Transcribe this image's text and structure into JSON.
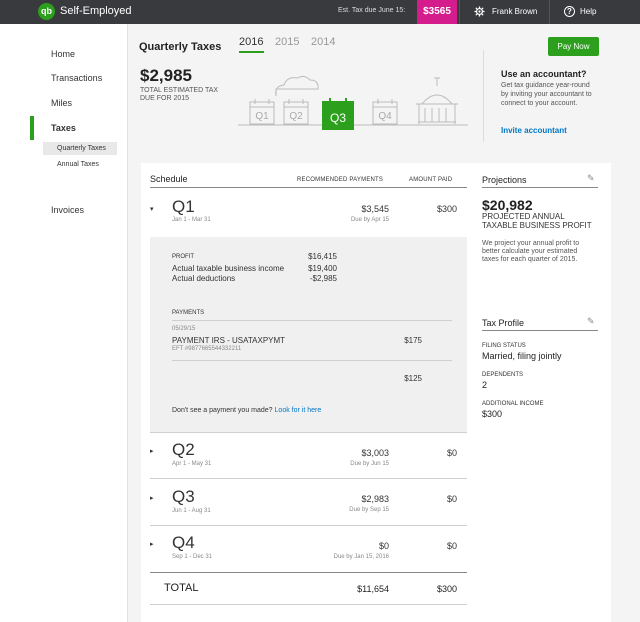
{
  "topbar": {
    "app_title": "Self-Employed",
    "tax_due_label": "Est. Tax due June 15:",
    "tax_due_amount": "$3565",
    "user_name": "Frank Brown",
    "help_label": "Help",
    "colors": {
      "bar": "#393a3d",
      "badge": "#d51c8c",
      "brand": "#2ca01c"
    }
  },
  "sidebar": {
    "items": [
      {
        "label": "Home"
      },
      {
        "label": "Transactions"
      },
      {
        "label": "Miles"
      },
      {
        "label": "Taxes",
        "active": true
      },
      {
        "label": "Invoices"
      }
    ],
    "subitems": [
      {
        "label": "Quarterly Taxes",
        "active": true
      },
      {
        "label": "Annual Taxes"
      }
    ]
  },
  "header": {
    "title": "Quarterly Taxes",
    "years": [
      "2016",
      "2015",
      "2014"
    ],
    "selected_year": "2016",
    "est_amount": "$2,985",
    "est_label": "TOTAL ESTIMATED TAX DUE FOR 2015",
    "calendar_labels": [
      "Q1",
      "Q2",
      "Q3",
      "Q4"
    ],
    "current_quarter": "Q3",
    "pay_now": "Pay Now",
    "accountant": {
      "title": "Use an accountant?",
      "text": "Get tax guidance year-round by inviting your accountant to connect to your account.",
      "link": "Invite accountant"
    }
  },
  "schedule": {
    "title": "Schedule",
    "col_recommended": "RECOMMENDED PAYMENTS",
    "col_paid": "AMOUNT PAID",
    "quarters": [
      {
        "label": "Q1",
        "dates": "Jan 1 - Mar 31",
        "recommended": "$3,545",
        "due": "Due by Apr 15",
        "paid": "$300",
        "expanded": true
      },
      {
        "label": "Q2",
        "dates": "Apr 1 - May 31",
        "recommended": "$3,003",
        "due": "Due by Jun 15",
        "paid": "$0"
      },
      {
        "label": "Q3",
        "dates": "Jun 1 - Aug 31",
        "recommended": "$2,983",
        "due": "Due by Sep 15",
        "paid": "$0"
      },
      {
        "label": "Q4",
        "dates": "Sep 1 - Dec 31",
        "recommended": "$0",
        "due": "Due by Jan 15, 2016",
        "paid": "$0"
      }
    ],
    "detail": {
      "profit_label": "PROFIT",
      "profit_value": "$16,415",
      "income_label": "Actual taxable business income",
      "income_value": "$19,400",
      "deductions_label": "Actual deductions",
      "deductions_value": "-$2,985",
      "payments_label": "PAYMENTS",
      "payment_date": "05/29/15",
      "payment_name": "PAYMENT IRS - USATAXPYMT",
      "payment_eft": "EFT #9877665544332211",
      "payment_amount": "$175",
      "payment_amount2": "$125",
      "missing_text": "Don't see a payment you made?",
      "missing_link": "Look for it here"
    },
    "total_label": "TOTAL",
    "total_recommended": "$11,654",
    "total_paid": "$300"
  },
  "projections": {
    "title": "Projections",
    "amount": "$20,982",
    "label": "PROJECTED ANNUAL TAXABLE BUSINESS PROFIT",
    "text": "We project your annual profit to better calculate your estimated taxes for each quarter of 2015."
  },
  "tax_profile": {
    "title": "Tax Profile",
    "filing_label": "FILING STATUS",
    "filing_value": "Married, filing jointly",
    "dependents_label": "DEPENDENTS",
    "dependents_value": "2",
    "income_label": "ADDITIONAL INCOME",
    "income_value": "$300"
  }
}
